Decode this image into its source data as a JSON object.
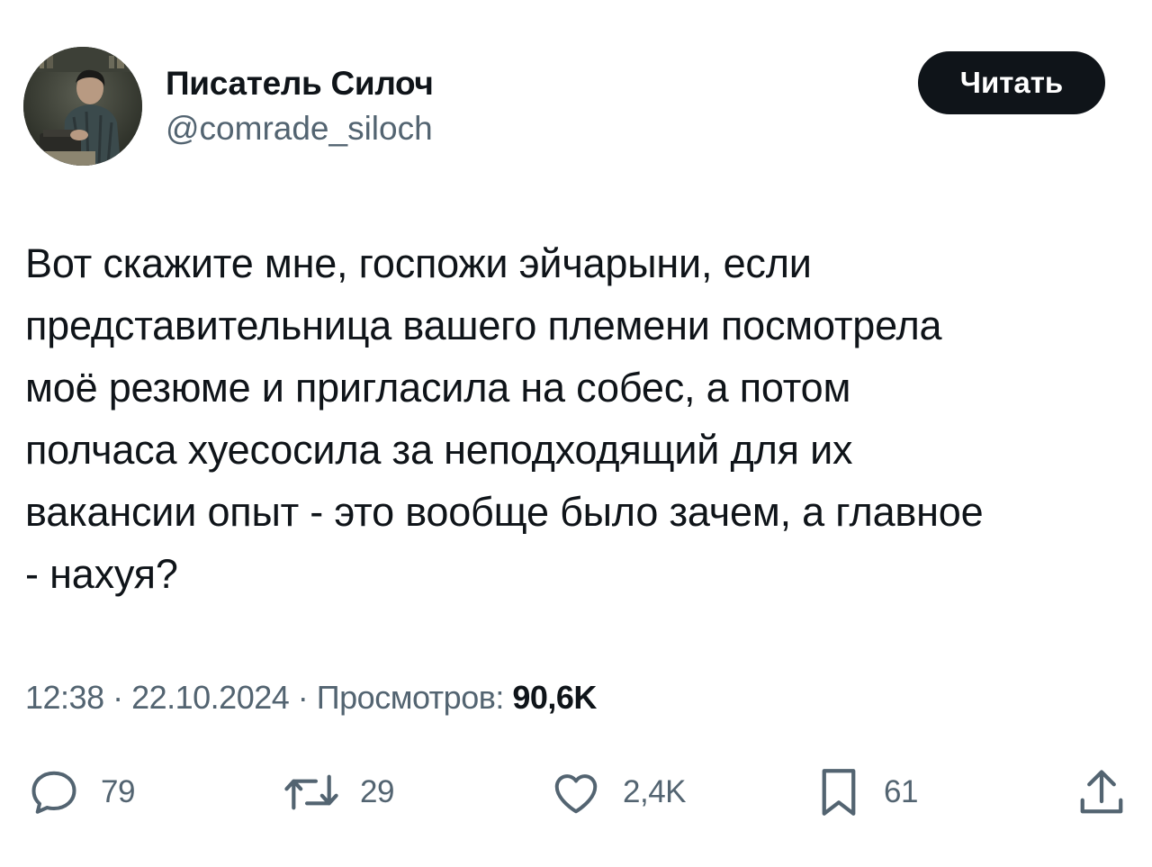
{
  "author": {
    "display_name": "Писатель Силоч",
    "handle": "@comrade_siloch",
    "avatar_icon": "user-avatar-photo"
  },
  "follow_button": {
    "label": "Читать",
    "color": "#0f1419"
  },
  "tweet": {
    "text": "Вот скажите мне, госпожи эйчарыни, если\nпредставительница вашего племени посмотрела\nмоё резюме и пригласила на собес, а потом\nполчаса хуесосила за неподходящий для их\nвакансии опыт - это вообще было зачем, а главное\n- нахуя?"
  },
  "meta": {
    "time": "12:38",
    "separator": " · ",
    "date": "22.10.2024",
    "views_label": "Просмотров:",
    "views_count": "90,6K"
  },
  "actions": {
    "reply": {
      "icon": "reply-icon",
      "count": "79"
    },
    "retweet": {
      "icon": "retweet-icon",
      "count": "29"
    },
    "like": {
      "icon": "heart-icon",
      "count": "2,4K"
    },
    "bookmark": {
      "icon": "bookmark-icon",
      "count": "61"
    },
    "share": {
      "icon": "share-icon"
    }
  },
  "colors": {
    "text_primary": "#0f1419",
    "text_secondary": "#536471",
    "background": "#ffffff"
  }
}
